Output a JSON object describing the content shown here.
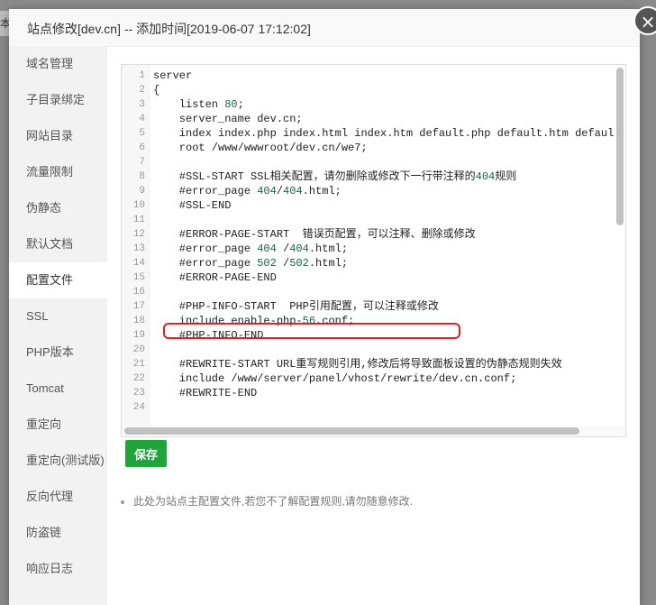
{
  "background": {
    "fragment_text": "本"
  },
  "dialog": {
    "title": "站点修改[dev.cn] -- 添加时间[2019-06-07 17:12:02]",
    "close_glyph": "×"
  },
  "sidebar": {
    "items": [
      {
        "label": "域名管理"
      },
      {
        "label": "子目录绑定"
      },
      {
        "label": "网站目录"
      },
      {
        "label": "流量限制"
      },
      {
        "label": "伪静态"
      },
      {
        "label": "默认文档"
      },
      {
        "label": "配置文件",
        "active": true
      },
      {
        "label": "SSL"
      },
      {
        "label": "PHP版本"
      },
      {
        "label": "Tomcat"
      },
      {
        "label": "重定向"
      },
      {
        "label": "重定向(测试版)"
      },
      {
        "label": "反向代理"
      },
      {
        "label": "防盗链"
      },
      {
        "label": "响应日志"
      }
    ]
  },
  "editor": {
    "lines": [
      {
        "n": "1",
        "text": "server"
      },
      {
        "n": "2",
        "text": "{"
      },
      {
        "n": "3",
        "text": "    listen 80;"
      },
      {
        "n": "4",
        "text": "    server_name dev.cn;"
      },
      {
        "n": "5",
        "text": "    index index.php index.html index.htm default.php default.htm defaul"
      },
      {
        "n": "6",
        "text": "    root /www/wwwroot/dev.cn/we7;"
      },
      {
        "n": "7",
        "text": ""
      },
      {
        "n": "8",
        "text": "    #SSL-START SSL相关配置，请勿删除或修改下一行带注释的404规则"
      },
      {
        "n": "9",
        "text": "    #error_page 404/404.html;"
      },
      {
        "n": "10",
        "text": "    #SSL-END"
      },
      {
        "n": "11",
        "text": ""
      },
      {
        "n": "12",
        "text": "    #ERROR-PAGE-START  错误页配置，可以注释、删除或修改"
      },
      {
        "n": "13",
        "text": "    #error_page 404 /404.html;"
      },
      {
        "n": "14",
        "text": "    #error_page 502 /502.html;"
      },
      {
        "n": "15",
        "text": "    #ERROR-PAGE-END"
      },
      {
        "n": "16",
        "text": ""
      },
      {
        "n": "17",
        "text": "    #PHP-INFO-START  PHP引用配置，可以注释或修改"
      },
      {
        "n": "18",
        "text": "    include enable-php-56.conf;"
      },
      {
        "n": "19",
        "text": "    #PHP-INFO-END"
      },
      {
        "n": "20",
        "text": ""
      },
      {
        "n": "21",
        "text": "    #REWRITE-START URL重写规则引用,修改后将导致面板设置的伪静态规则失效"
      },
      {
        "n": "22",
        "text": "    include /www/server/panel/vhost/rewrite/dev.cn.conf;"
      },
      {
        "n": "23",
        "text": "    #REWRITE-END"
      },
      {
        "n": "24",
        "text": ""
      }
    ],
    "highlighted_line": "18",
    "number_color": "#116644"
  },
  "save_label": "保存",
  "tip": "此处为站点主配置文件,若您不了解配置规则,请勿随意修改.",
  "colors": {
    "accent_green": "#20a53a",
    "highlight_red": "#e02020"
  }
}
